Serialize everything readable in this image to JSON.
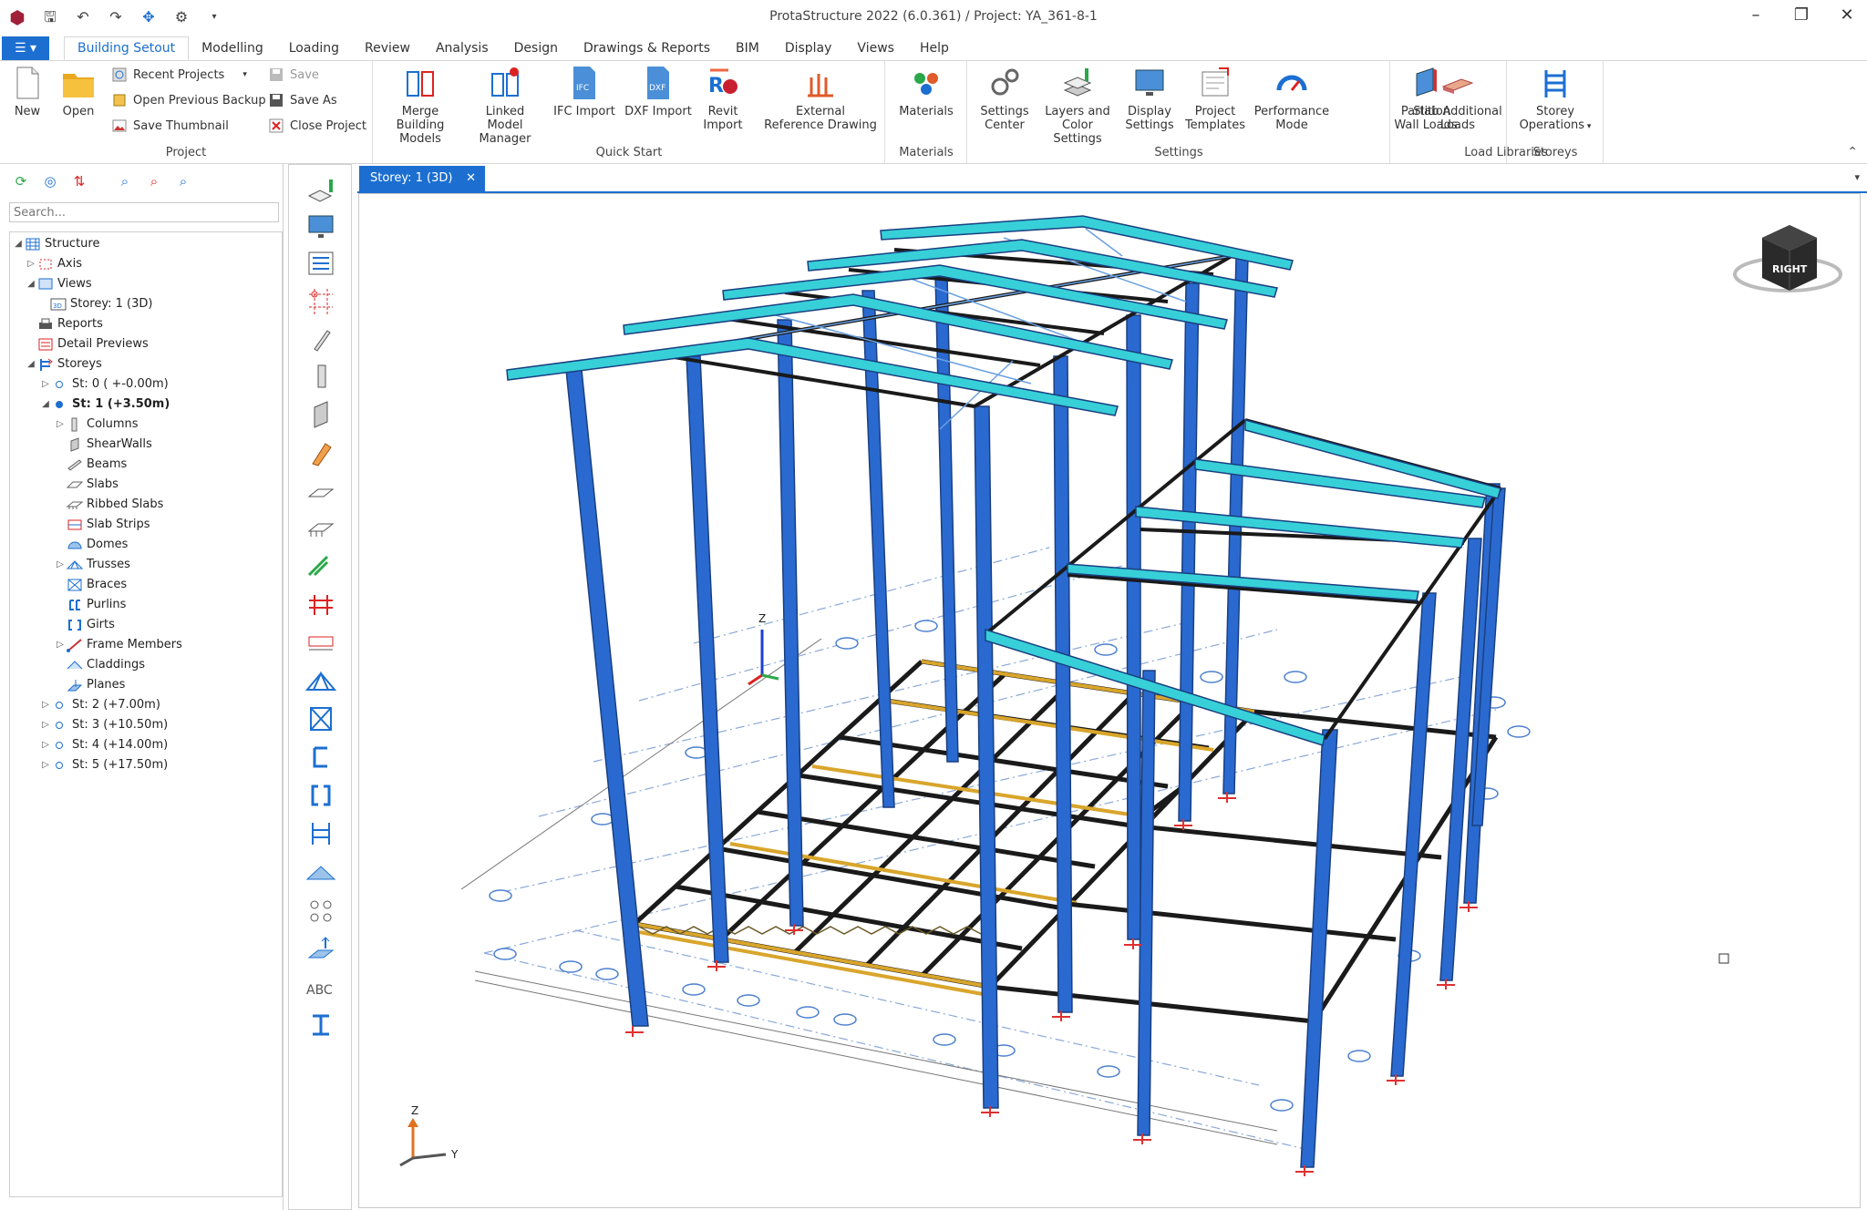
{
  "window": {
    "title": "ProtaStructure 2022 (6.0.361) / Project: YA_361-8-1"
  },
  "ribbon_tabs": [
    {
      "label": "Building Setout",
      "active": true
    },
    {
      "label": "Modelling"
    },
    {
      "label": "Loading"
    },
    {
      "label": "Review"
    },
    {
      "label": "Analysis"
    },
    {
      "label": "Design"
    },
    {
      "label": "Drawings & Reports"
    },
    {
      "label": "BIM"
    },
    {
      "label": "Display"
    },
    {
      "label": "Views"
    },
    {
      "label": "Help"
    }
  ],
  "ribbon": {
    "project": {
      "label": "Project",
      "new": "New",
      "open": "Open",
      "recent": "Recent Projects",
      "open_backup": "Open Previous Backup",
      "save_thumb": "Save Thumbnail",
      "save": "Save",
      "save_as": "Save As",
      "close": "Close Project"
    },
    "quickstart": {
      "label": "Quick Start",
      "merge_l1": "Merge Building",
      "merge_l2": "Models",
      "linked_l1": "Linked Model",
      "linked_l2": "Manager",
      "ifc": "IFC Import",
      "dxf": "DXF Import",
      "revit_l1": "Revit",
      "revit_l2": "Import",
      "extref_l1": "External",
      "extref_l2": "Reference Drawing"
    },
    "materials": {
      "label": "Materials",
      "btn": "Materials"
    },
    "settings": {
      "label": "Settings",
      "center_l1": "Settings",
      "center_l2": "Center",
      "layers_l1": "Layers and",
      "layers_l2": "Color Settings",
      "display_l1": "Display",
      "display_l2": "Settings",
      "templates_l1": "Project",
      "templates_l2": "Templates",
      "perf_l1": "Performance",
      "perf_l2": "Mode"
    },
    "loadlib": {
      "label": "Load Libraries",
      "partition_l1": "Partition",
      "partition_l2": "Wall Loads",
      "slab_l1": "Slab Additional",
      "slab_l2": "Loads"
    },
    "storeys": {
      "label": "Storeys",
      "ops_l1": "Storey",
      "ops_l2": "Operations"
    }
  },
  "left_panel": {
    "search_placeholder": "Search...",
    "tree": {
      "structure": "Structure",
      "axis": "Axis",
      "views": "Views",
      "storey_view": "Storey: 1 (3D)",
      "reports": "Reports",
      "detail_previews": "Detail Previews",
      "storeys": "Storeys",
      "st0": "St: 0 ( +-0.00m)",
      "st1": "St: 1 (+3.50m)",
      "columns": "Columns",
      "shearwalls": "ShearWalls",
      "beams": "Beams",
      "slabs": "Slabs",
      "ribbed": "Ribbed Slabs",
      "slabstrips": "Slab Strips",
      "domes": "Domes",
      "trusses": "Trusses",
      "braces": "Braces",
      "purlins": "Purlins",
      "girts": "Girts",
      "frame": "Frame Members",
      "claddings": "Claddings",
      "planes": "Planes",
      "st2": "St: 2 (+7.00m)",
      "st3": "St: 3 (+10.50m)",
      "st4": "St: 4 (+14.00m)",
      "st5": "St: 5 (+17.50m)"
    }
  },
  "document": {
    "tab": "Storey: 1 (3D)",
    "viewcube_label": "RIGHT",
    "axis_z": "Z",
    "axis_y": "Y"
  },
  "colors": {
    "accent": "#1c6fd1",
    "column": "#1f5fb8",
    "rafter": "#37d0d8",
    "truss": "#d9a52b",
    "frame": "#1a1a1a"
  }
}
